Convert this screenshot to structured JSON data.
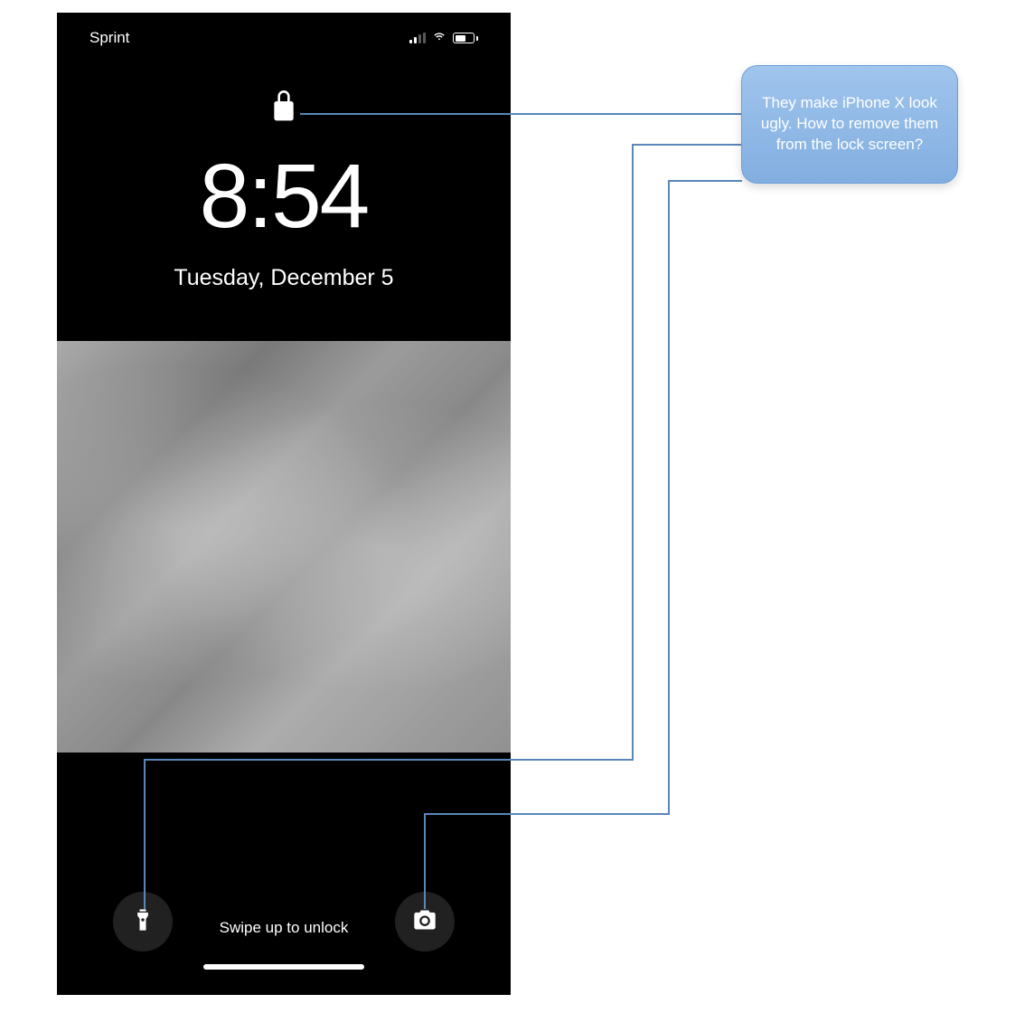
{
  "statusBar": {
    "carrier": "Sprint"
  },
  "lockScreen": {
    "time": "8:54",
    "date": "Tuesday, December 5",
    "swipeHint": "Swipe up to unlock"
  },
  "callout": {
    "text": "They make iPhone X look ugly. How to remove them from the lock screen?"
  }
}
